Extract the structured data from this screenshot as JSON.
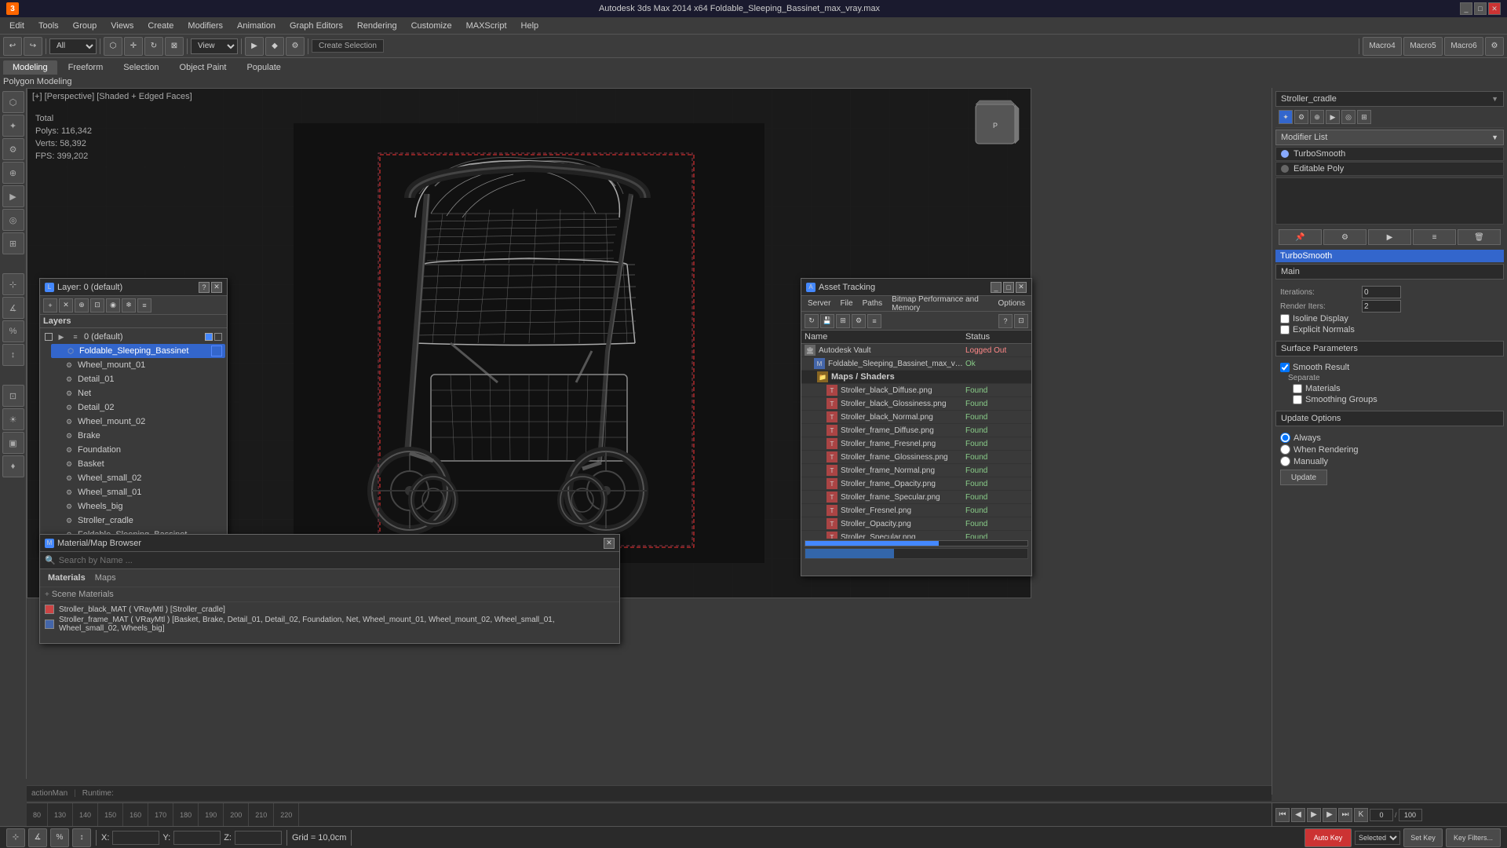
{
  "titleBar": {
    "appName": "Autodesk 3ds Max 2014 x64",
    "fileName": "Foldable_Sleeping_Bassinet_max_vray.max",
    "title": "Autodesk 3ds Max 2014 x64    Foldable_Sleeping_Bassinet_max_vray.max",
    "winControls": [
      "_",
      "□",
      "✕"
    ]
  },
  "menuBar": {
    "items": [
      "Edit",
      "Tools",
      "Group",
      "Views",
      "Create",
      "Modifiers",
      "Animation",
      "Graph Editors",
      "Rendering",
      "Customize",
      "MAXScript",
      "Help"
    ]
  },
  "tabs": {
    "items": [
      "Modeling",
      "Freeform",
      "Selection",
      "Object Paint",
      "Populate"
    ],
    "active": "Modeling",
    "sublabel": "Polygon Modeling"
  },
  "viewport": {
    "label": "[+] [Perspective] [Shaded + Edged Faces]",
    "stats": {
      "totalLabel": "Total",
      "polysLabel": "Polys:",
      "polysValue": "116,342",
      "vertsLabel": "Verts:",
      "vertsValue": "58,392",
      "fpsLabel": "FPS:",
      "fpsValue": "399,202"
    }
  },
  "layersPanel": {
    "title": "Layer: 0 (default)",
    "header": "Layers",
    "items": [
      {
        "name": "0 (default)",
        "level": 0,
        "type": "layer",
        "active": true
      },
      {
        "name": "Foldable_Sleeping_Bassinet",
        "level": 1,
        "type": "object",
        "selected": true
      },
      {
        "name": "Wheel_mount_01",
        "level": 2,
        "type": "object"
      },
      {
        "name": "Detail_01",
        "level": 2,
        "type": "object"
      },
      {
        "name": "Net",
        "level": 2,
        "type": "object"
      },
      {
        "name": "Detail_02",
        "level": 2,
        "type": "object"
      },
      {
        "name": "Wheel_mount_02",
        "level": 2,
        "type": "object"
      },
      {
        "name": "Brake",
        "level": 2,
        "type": "object"
      },
      {
        "name": "Foundation",
        "level": 2,
        "type": "object"
      },
      {
        "name": "Basket",
        "level": 2,
        "type": "object"
      },
      {
        "name": "Wheel_small_02",
        "level": 2,
        "type": "object"
      },
      {
        "name": "Wheel_small_01",
        "level": 2,
        "type": "object"
      },
      {
        "name": "Wheels_big",
        "level": 2,
        "type": "object"
      },
      {
        "name": "Stroller_cradle",
        "level": 2,
        "type": "object"
      },
      {
        "name": "Foldable_Sleeping_Bassinet",
        "level": 2,
        "type": "object"
      }
    ]
  },
  "assetTracking": {
    "title": "Asset Tracking",
    "menus": [
      "Server",
      "File",
      "Paths",
      "Bitmap Performance and Memory",
      "Options"
    ],
    "tableHeader": {
      "name": "Name",
      "status": "Status"
    },
    "rows": [
      {
        "name": "Autodesk Vault",
        "status": "Logged Out",
        "statusType": "logged-out",
        "indent": 0
      },
      {
        "name": "Foldable_Sleeping_Bassinet_max_vray.max",
        "status": "Ok",
        "statusType": "ok",
        "indent": 1
      },
      {
        "name": "Maps / Shaders",
        "status": "",
        "statusType": "section",
        "indent": 1
      },
      {
        "name": "Stroller_black_Diffuse.png",
        "status": "Found",
        "statusType": "ok",
        "indent": 2
      },
      {
        "name": "Stroller_black_Glossiness.png",
        "status": "Found",
        "statusType": "ok",
        "indent": 2
      },
      {
        "name": "Stroller_black_Normal.png",
        "status": "Found",
        "statusType": "ok",
        "indent": 2
      },
      {
        "name": "Stroller_frame_Diffuse.png",
        "status": "Found",
        "statusType": "ok",
        "indent": 2
      },
      {
        "name": "Stroller_frame_Fresnel.png",
        "status": "Found",
        "statusType": "ok",
        "indent": 2
      },
      {
        "name": "Stroller_frame_Glossiness.png",
        "status": "Found",
        "statusType": "ok",
        "indent": 2
      },
      {
        "name": "Stroller_frame_Normal.png",
        "status": "Found",
        "statusType": "ok",
        "indent": 2
      },
      {
        "name": "Stroller_frame_Opacity.png",
        "status": "Found",
        "statusType": "ok",
        "indent": 2
      },
      {
        "name": "Stroller_frame_Specular.png",
        "status": "Found",
        "statusType": "ok",
        "indent": 2
      },
      {
        "name": "Stroller_Fresnel.png",
        "status": "Found",
        "statusType": "ok",
        "indent": 2
      },
      {
        "name": "Stroller_Opacity.png",
        "status": "Found",
        "statusType": "ok",
        "indent": 2
      },
      {
        "name": "Stroller_Specular.png",
        "status": "Found",
        "statusType": "ok",
        "indent": 2
      }
    ]
  },
  "materialBrowser": {
    "title": "Material/Map Browser",
    "searchPlaceholder": "Search by Name ...",
    "sections": [
      "Materials",
      "Maps"
    ],
    "sceneLabel": "Scene Materials",
    "materials": [
      {
        "name": "Stroller_black_MAT ( VRayMtl ) [Stroller_cradle]",
        "color": "red"
      },
      {
        "name": "Stroller_frame_MAT ( VRayMtl ) [Basket, Brake, Detail_01, Detail_02, Foundation, Net, Wheel_mount_01, Wheel_mount_02, Wheel_small_01, Wheel_small_02, Wheels_big]",
        "color": "blue"
      }
    ]
  },
  "rightPanel": {
    "objectName": "Stroller_cradle",
    "modifierListLabel": "Modifier List",
    "modifiers": [
      {
        "name": "TurboSmooth",
        "active": true
      },
      {
        "name": "Editable Poly",
        "active": false
      }
    ],
    "turbosmoothSection": "TurboSmooth",
    "params": {
      "iterationsLabel": "Iterations:",
      "iterationsValue": "0",
      "renderItersLabel": "Render Iters:",
      "renderItersValue": "2",
      "isolineDisplayLabel": "Isoline Display",
      "explicitNormalsLabel": "Explicit Normals"
    },
    "surfaceParams": {
      "label": "Surface Parameters",
      "smoothResultLabel": "Smooth Result",
      "separateLabel": "Separate",
      "materialsLabel": "Materials",
      "smoothingGroupsLabel": "Smoothing Groups"
    },
    "updateOptions": {
      "label": "Update Options",
      "alwaysLabel": "Always",
      "whenRenderingLabel": "When Rendering",
      "manuallyLabel": "Manually",
      "updateButton": "Update"
    }
  },
  "bottomBar": {
    "xLabel": "X:",
    "yLabel": "Y:",
    "zLabel": "Z:",
    "gridLabel": "Grid = 10,0cm",
    "autoKeyLabel": "Auto Key",
    "selectedLabel": "Selected",
    "setKeyLabel": "Set Key",
    "keyFiltersLabel": "Key Filters..."
  },
  "timeline": {
    "ticks": [
      "80",
      "130",
      "140",
      "150",
      "160",
      "170",
      "180",
      "190",
      "200",
      "210",
      "220"
    ]
  },
  "statusBar": {
    "actionText": "actionMan",
    "runtimeText": "Runtime:"
  }
}
